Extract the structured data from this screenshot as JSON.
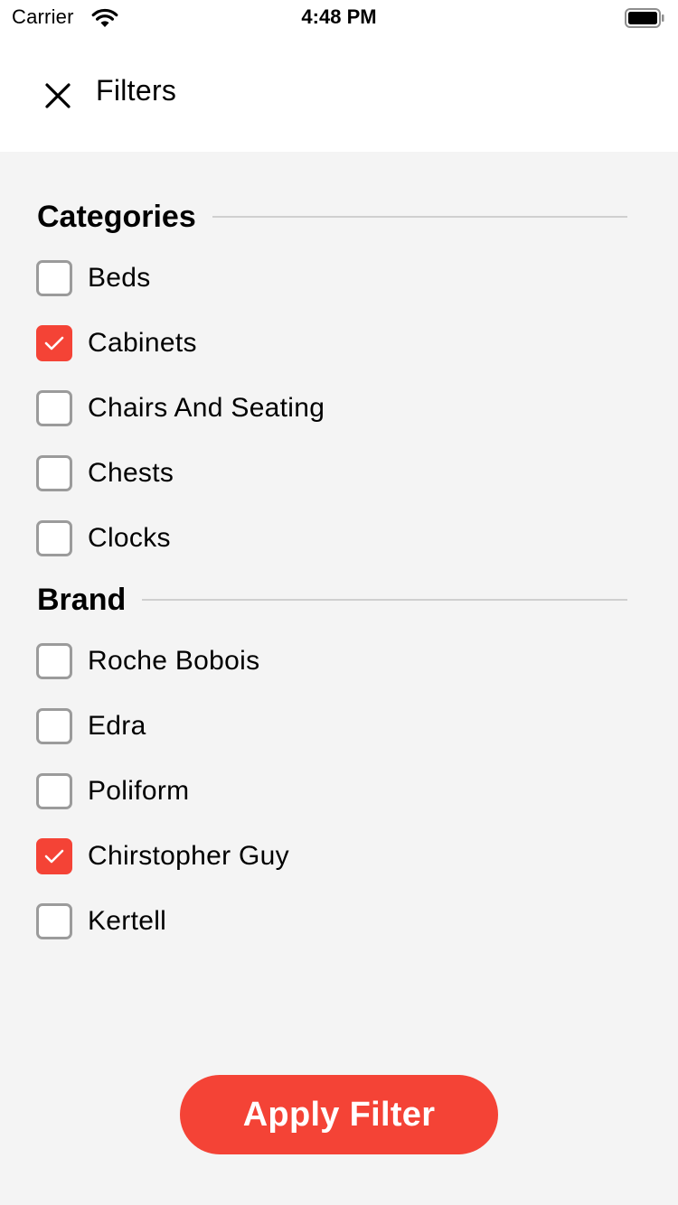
{
  "status_bar": {
    "carrier": "Carrier",
    "time": "4:48 PM",
    "icons": [
      "wifi-icon",
      "battery-icon"
    ]
  },
  "header": {
    "title": "Filters",
    "close_icon": "close-icon"
  },
  "sections": {
    "categories": {
      "title": "Categories",
      "options": [
        {
          "label": "Beds",
          "checked": false
        },
        {
          "label": "Cabinets",
          "checked": true
        },
        {
          "label": "Chairs And Seating",
          "checked": false
        },
        {
          "label": "Chests",
          "checked": false
        },
        {
          "label": "Clocks",
          "checked": false
        }
      ]
    },
    "brand": {
      "title": "Brand",
      "options": [
        {
          "label": "Roche Bobois",
          "checked": false
        },
        {
          "label": "Edra",
          "checked": false
        },
        {
          "label": "Poliform",
          "checked": false
        },
        {
          "label": "Chirstopher Guy",
          "checked": true
        },
        {
          "label": "Kertell",
          "checked": false
        }
      ]
    }
  },
  "apply_button": {
    "label": "Apply Filter"
  },
  "colors": {
    "accent": "#f44336",
    "background": "#f4f4f4",
    "checkbox_border": "#9b9b9b",
    "divider": "#cfcfcf"
  }
}
